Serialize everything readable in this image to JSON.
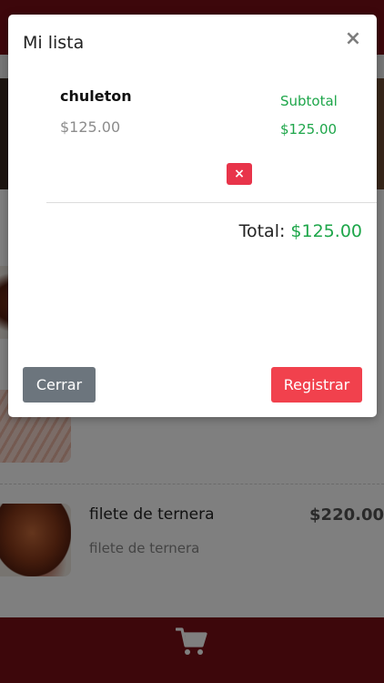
{
  "modal": {
    "title": "Mi lista",
    "close_symbol": "×",
    "cart_items": [
      {
        "name": "chuleton",
        "price": "$125.00",
        "subtotal_label": "Subtotal",
        "subtotal": "$125.00",
        "delete_symbol": "×"
      }
    ],
    "total_label": "Total:",
    "total_value": "$125.00",
    "buttons": {
      "close": "Cerrar",
      "register": "Registrar"
    }
  },
  "background": {
    "menu_items": [
      {
        "name": "",
        "description": "",
        "price": "",
        "image_icon": "meat-photo"
      },
      {
        "name": "",
        "description": "",
        "price": "",
        "image_icon": "fish-photo"
      },
      {
        "name": "filete de ternera",
        "description": "filete de ternera",
        "price": "$220.00",
        "image_icon": "steak-photo"
      }
    ],
    "cart_icon": "shopping-cart-icon"
  },
  "colors": {
    "brand": "#7a0f16",
    "accent_green": "#1ea64a",
    "danger": "#f1414d",
    "secondary": "#6c757d"
  }
}
